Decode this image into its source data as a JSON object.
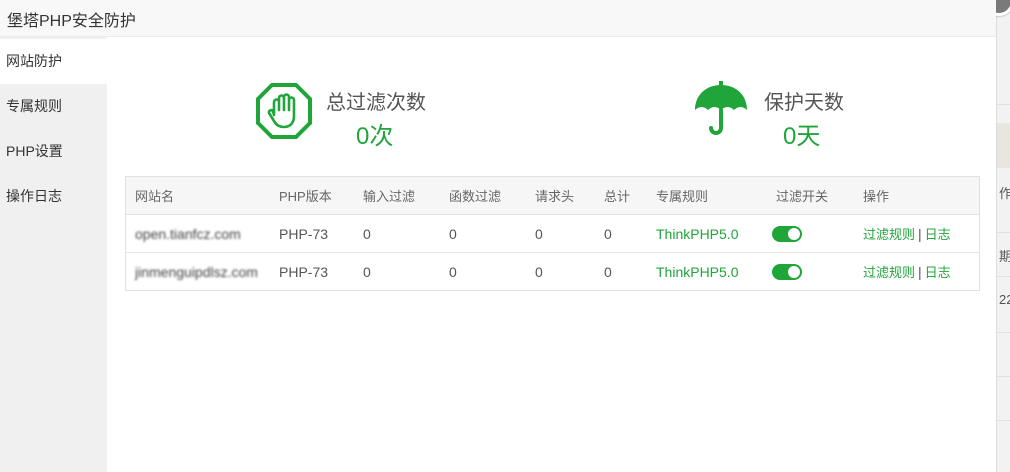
{
  "dialog": {
    "title": "堡塔PHP安全防护"
  },
  "sidebar": {
    "items": [
      {
        "label": "网站防护",
        "active": true
      },
      {
        "label": "专属规则",
        "active": false
      },
      {
        "label": "PHP设置",
        "active": false
      },
      {
        "label": "操作日志",
        "active": false
      }
    ]
  },
  "stats": {
    "total_filter": {
      "label": "总过滤次数",
      "value": "0次",
      "icon": "hand-stop-icon"
    },
    "protect_days": {
      "label": "保护天数",
      "value": "0天",
      "icon": "umbrella-icon"
    }
  },
  "table": {
    "headers": [
      "网站名",
      "PHP版本",
      "输入过滤",
      "函数过滤",
      "请求头",
      "总计",
      "专属规则",
      "过滤开关",
      "操作"
    ],
    "rows": [
      {
        "site": "open.tianfcz.com",
        "php": "PHP-73",
        "input": "0",
        "func": "0",
        "header": "0",
        "total": "0",
        "rule": "ThinkPHP5.0",
        "switch_on": true,
        "action_rules": "过滤规则",
        "action_sep": "|",
        "action_log": "日志"
      },
      {
        "site": "jinmenguipdlsz.com",
        "php": "PHP-73",
        "input": "0",
        "func": "0",
        "header": "0",
        "total": "0",
        "rule": "ThinkPHP5.0",
        "switch_on": true,
        "action_rules": "过滤规则",
        "action_sep": "|",
        "action_log": "日志"
      }
    ]
  },
  "background_page": {
    "fragment_1": "作",
    "fragment_2": "期",
    "fragment_3": "22"
  },
  "colors": {
    "accent": "#20a53a",
    "sidebar_bg": "#f0f0f0",
    "header_bg": "#f6f6f6"
  }
}
